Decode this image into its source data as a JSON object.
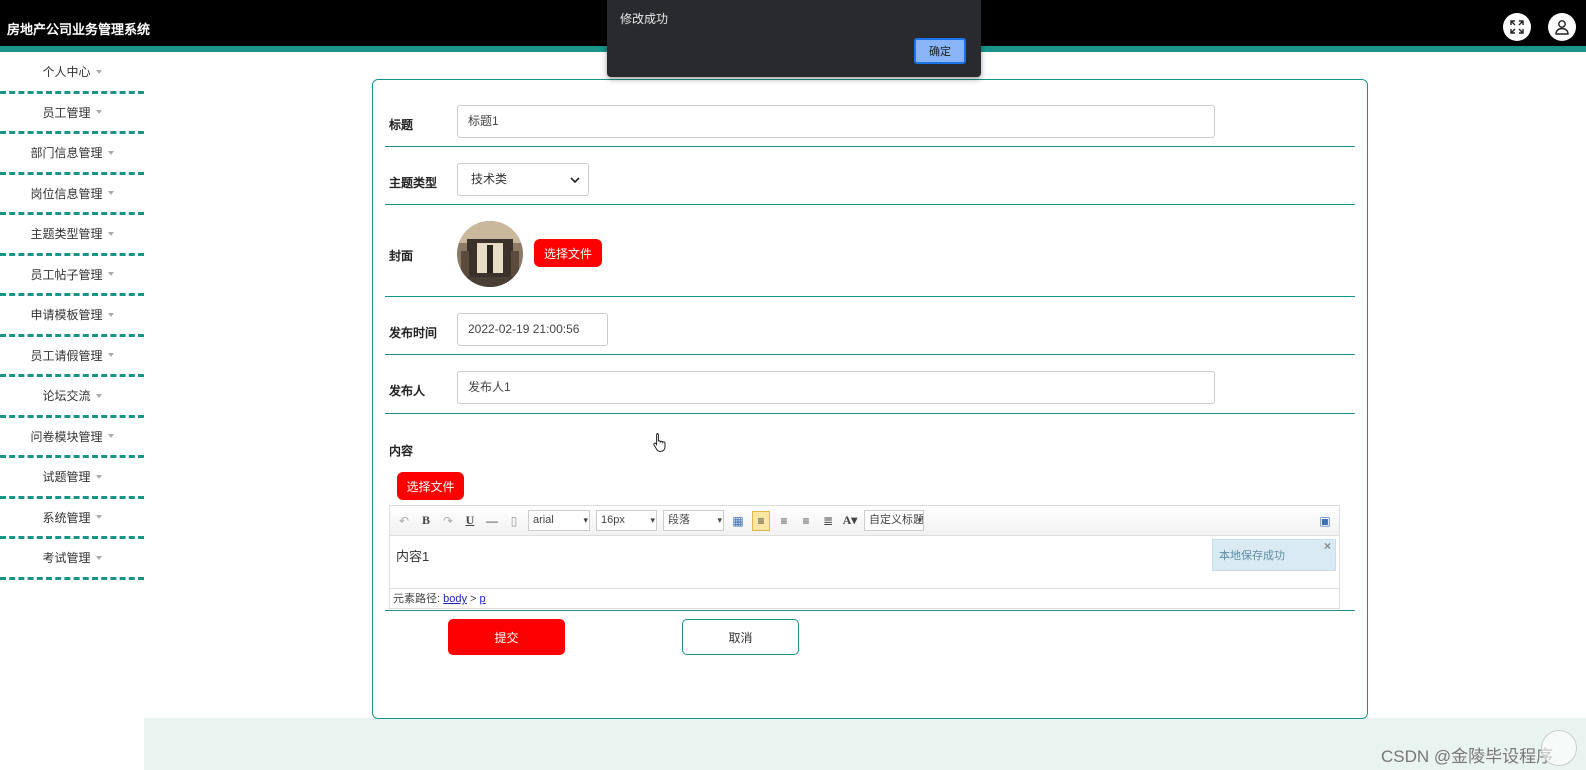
{
  "header": {
    "title": "房地产公司业务管理系统"
  },
  "sidebar": {
    "items": [
      {
        "label": "个人中心"
      },
      {
        "label": "员工管理"
      },
      {
        "label": "部门信息管理"
      },
      {
        "label": "岗位信息管理"
      },
      {
        "label": "主题类型管理"
      },
      {
        "label": "员工帖子管理"
      },
      {
        "label": "申请模板管理"
      },
      {
        "label": "员工请假管理"
      },
      {
        "label": "论坛交流"
      },
      {
        "label": "问卷模块管理"
      },
      {
        "label": "试题管理"
      },
      {
        "label": "系统管理"
      },
      {
        "label": "考试管理"
      }
    ]
  },
  "form": {
    "title_label": "标题",
    "title_value": "标题1",
    "topic_type_label": "主题类型",
    "topic_type_value": "技术类",
    "cover_label": "封面",
    "choose_file_label": "选择文件",
    "publish_time_label": "发布时间",
    "publish_time_value": "2022-02-19 21:00:56",
    "publisher_label": "发布人",
    "publisher_value": "发布人1",
    "content_label": "内容",
    "content_choose_file_label": "选择文件",
    "submit_label": "提交",
    "cancel_label": "取消"
  },
  "editor": {
    "font_family": "arial",
    "font_size": "16px",
    "paragraph": "段落",
    "custom_title": "自定义标题",
    "body_text": "内容1",
    "saved_toast": "本地保存成功",
    "path_label": "元素路径:",
    "path_body": "body",
    "path_sep": ">",
    "path_p": "p"
  },
  "alert": {
    "message": "修改成功",
    "ok_label": "确定"
  },
  "watermark": "CSDN @金陵毕设程序",
  "colors": {
    "accent": "#1a9489",
    "primary_button": "#ff0000",
    "topbar": "#000000"
  },
  "icons": {
    "fullscreen": "expand-icon",
    "user": "user-icon"
  }
}
